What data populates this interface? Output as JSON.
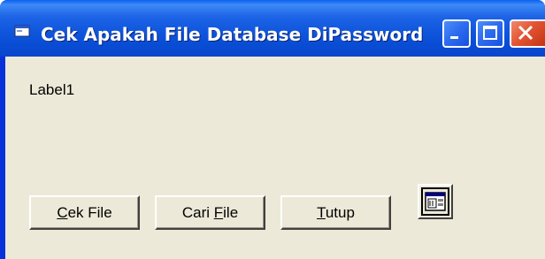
{
  "window": {
    "title": "Cek Apakah File Database DiPassword",
    "icon": "form-window-icon",
    "controls": [
      "minimize",
      "maximize",
      "close"
    ]
  },
  "form": {
    "label1": "Label1",
    "buttons": {
      "cek_file": {
        "prefix": "",
        "mnemonic": "C",
        "suffix": "ek File"
      },
      "cari_file": {
        "prefix": "Cari ",
        "mnemonic": "F",
        "suffix": "ile"
      },
      "tutup": {
        "prefix": "",
        "mnemonic": "T",
        "suffix": "utup"
      }
    },
    "common_dialog_icon": "common-dialog-control-icon"
  },
  "colors": {
    "titlebar": "#0a50d8",
    "client": "#ece9d8",
    "close": "#e25433"
  }
}
